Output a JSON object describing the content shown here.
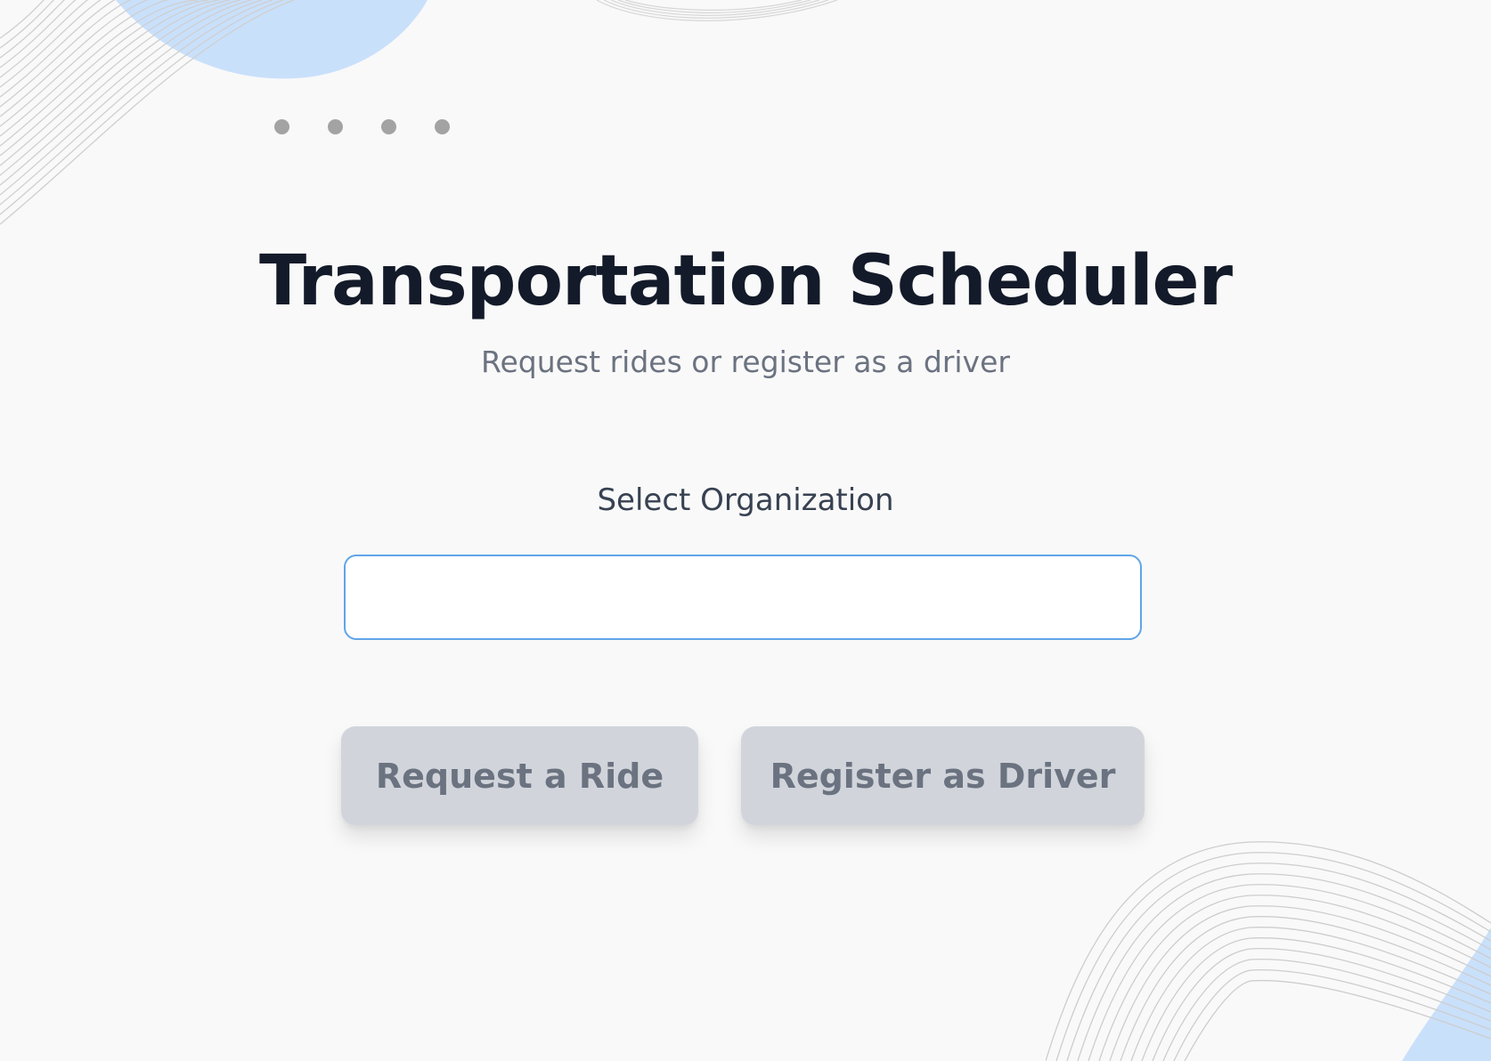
{
  "header": {
    "title": "Transportation Scheduler",
    "subtitle": "Request rides or register as a driver"
  },
  "form": {
    "organization_label": "Select Organization",
    "organization_value": "",
    "organization_placeholder": ""
  },
  "actions": {
    "request_ride_label": "Request a Ride",
    "register_driver_label": "Register as Driver"
  },
  "pager": {
    "dot_count": 4
  },
  "colors": {
    "background": "#f9f9f9",
    "title": "#131a29",
    "subtitle": "#6b7280",
    "input_border": "#60a5e8",
    "button_bg": "#d1d5db",
    "button_text": "#6b7280",
    "blob": "#c9e0fb"
  }
}
